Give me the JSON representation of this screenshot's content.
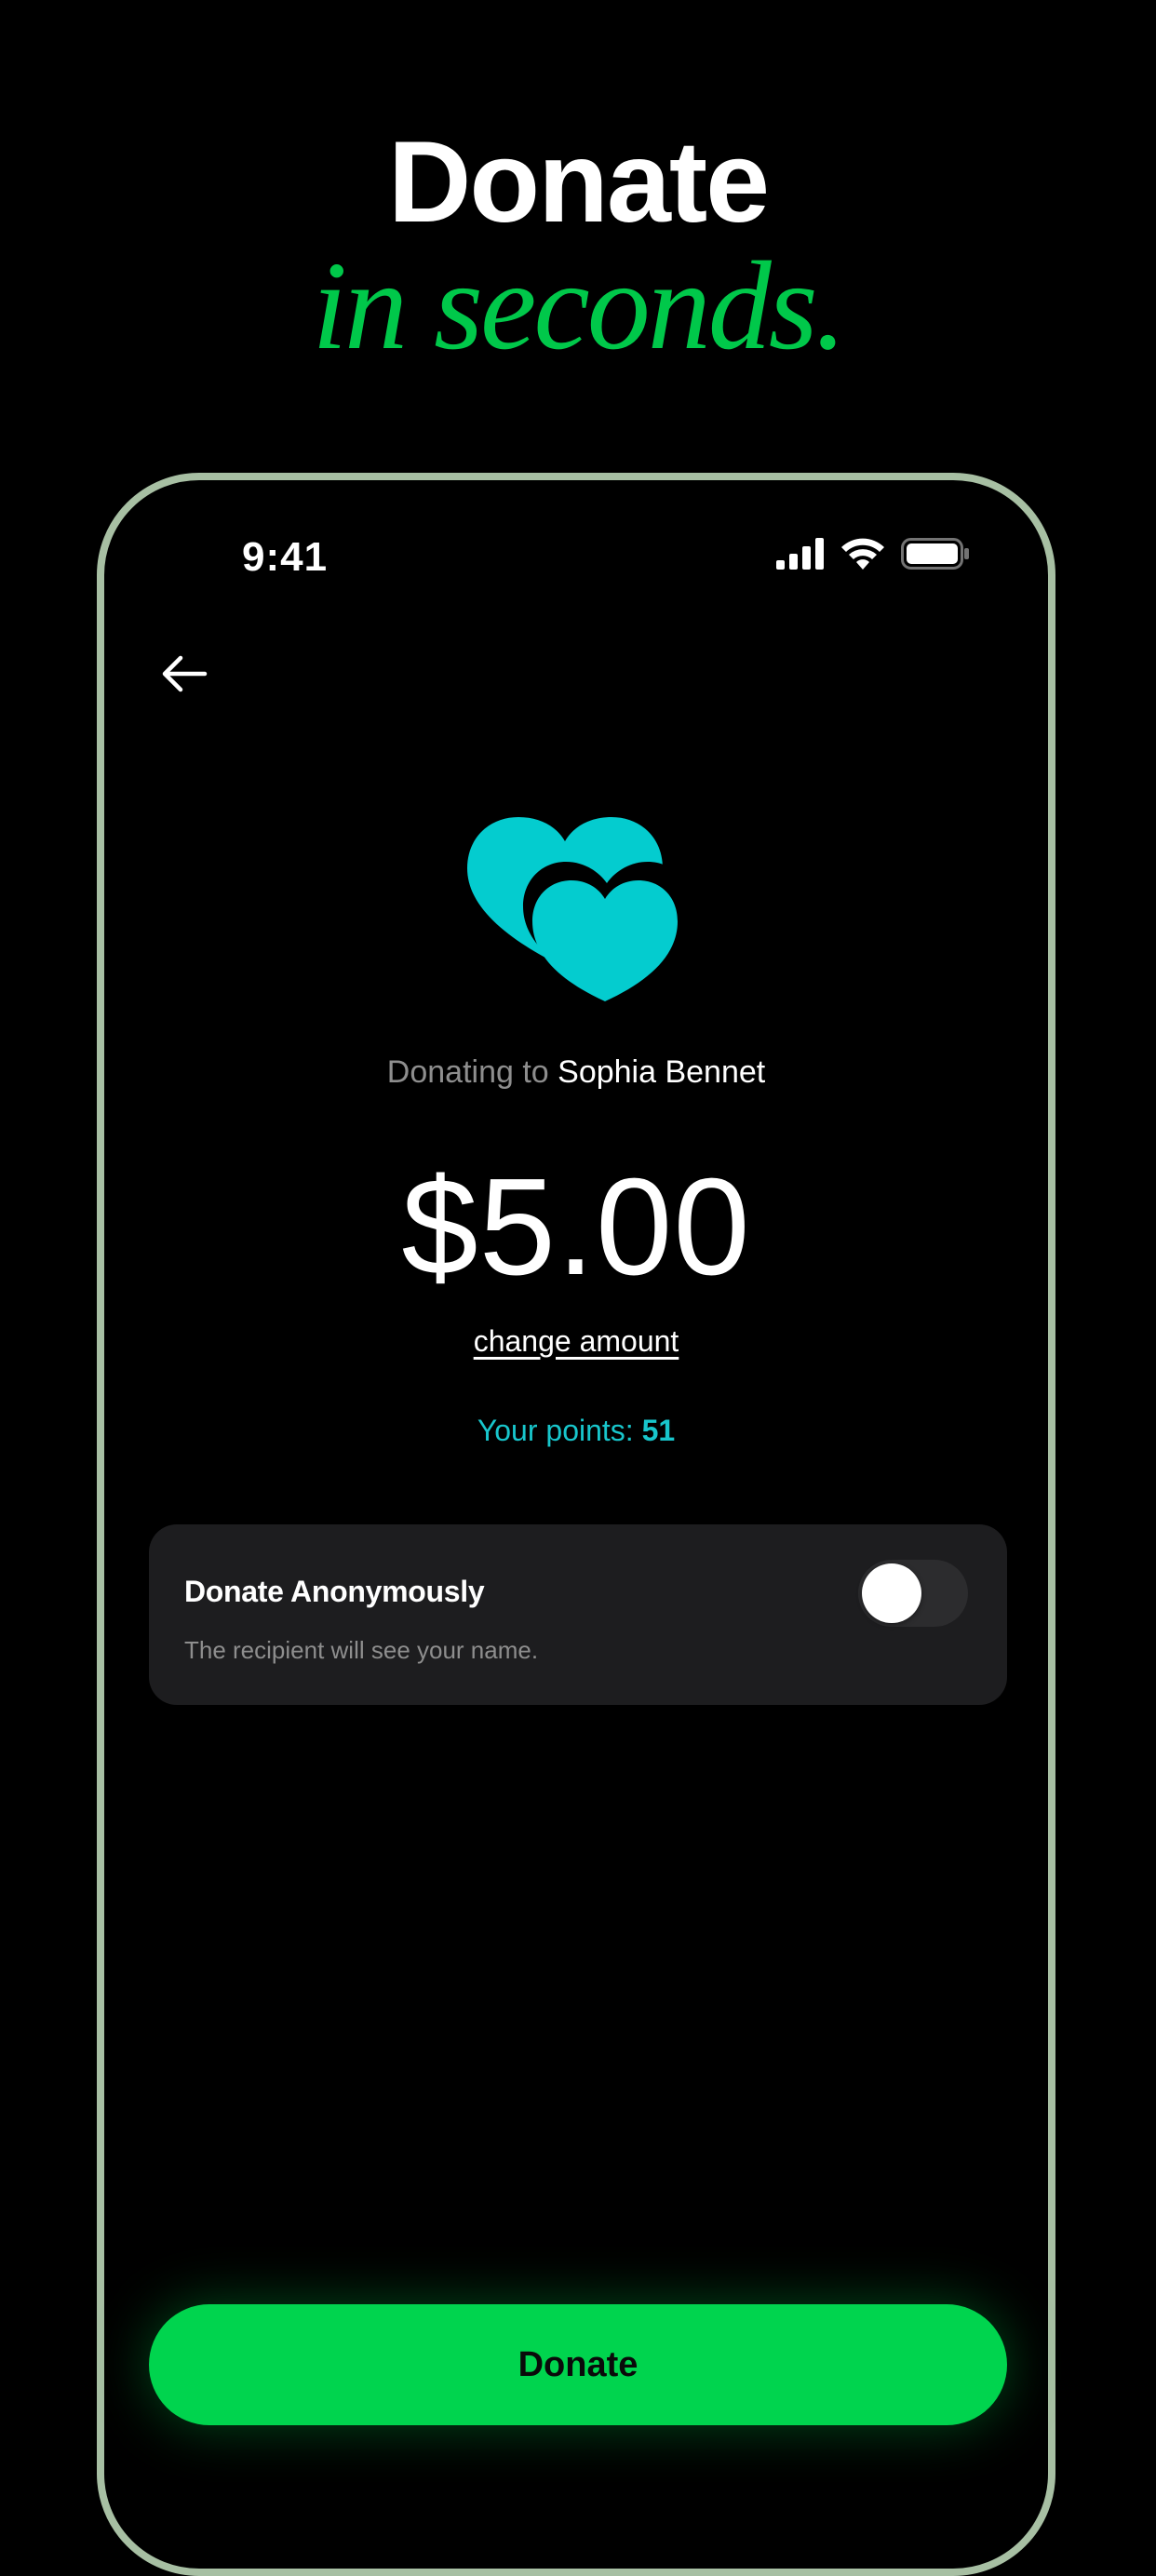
{
  "hero": {
    "headline": "Donate",
    "tagline": "in seconds."
  },
  "status_bar": {
    "time": "9:41",
    "icons": [
      "cellular-signal-icon",
      "wifi-icon",
      "battery-icon"
    ]
  },
  "nav": {
    "back_icon": "arrow-left-icon"
  },
  "donation": {
    "illustration_icon": "two-hearts-icon",
    "prefix": "Donating to",
    "recipient": "Sophia Bennet",
    "amount": "$5.00",
    "change_amount_label": "change amount",
    "points_label": "Your points:",
    "points_value": "51"
  },
  "anonymous": {
    "title": "Donate Anonymously",
    "subtitle": "The recipient will see your name.",
    "enabled": false
  },
  "action": {
    "donate_label": "Donate"
  },
  "colors": {
    "background": "#000000",
    "accent_green": "#00d44e",
    "tagline_green": "#00c84a",
    "teal": "#04cccf",
    "points_teal": "#18c6cc",
    "phone_frame": "#a7bfa3",
    "card": "#1d1d1f",
    "muted_text": "#8e8e8e"
  }
}
